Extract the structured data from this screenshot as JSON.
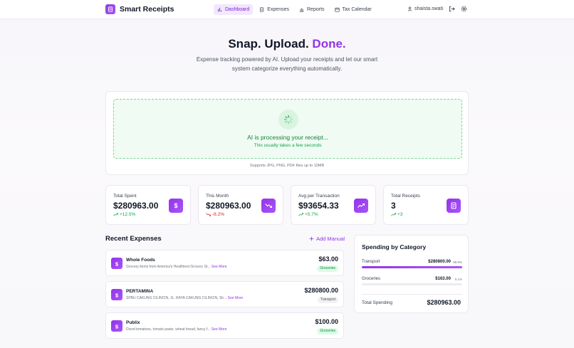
{
  "app": {
    "name": "Smart Receipts"
  },
  "nav": [
    {
      "label": "Dashboard",
      "icon": "bar-chart-icon",
      "active": true
    },
    {
      "label": "Expenses",
      "icon": "receipt-icon",
      "active": false
    },
    {
      "label": "Reports",
      "icon": "bar-chart-icon",
      "active": false
    },
    {
      "label": "Tax Calendar",
      "icon": "calendar-icon",
      "active": false
    }
  ],
  "user": {
    "name": "shaista.swati"
  },
  "hero": {
    "title_main": "Snap. Upload.",
    "title_accent": "Done.",
    "subtitle": "Expense tracking powered by AI. Upload your receipts and let our smart system categorize everything automatically."
  },
  "upload": {
    "status": "AI is processing your receipt...",
    "status_sub": "This usually takes a few seconds",
    "supports": "Supports JPG, PNG, PDF files up to 10MB"
  },
  "stats": [
    {
      "label": "Total Spent",
      "value": "$280963.00",
      "change": "+12.5%",
      "direction": "up",
      "icon": "dollar-icon"
    },
    {
      "label": "This Month",
      "value": "$280963.00",
      "change": "-8.2%",
      "direction": "down",
      "icon": "trend-down-icon"
    },
    {
      "label": "Avg per Transaction",
      "value": "$93654.33",
      "change": "+5.7%",
      "direction": "up",
      "icon": "trend-up-icon"
    },
    {
      "label": "Total Receipts",
      "value": "3",
      "change": "+3",
      "direction": "up",
      "icon": "receipt-icon"
    }
  ],
  "recent": {
    "title": "Recent Expenses",
    "add_label": "Add Manual",
    "see_more": "See More",
    "items": [
      {
        "merchant": "Whole Foods",
        "description": "Grocery items from America's Healthiest Grocery St...",
        "amount": "$63.00",
        "category": "Groceries",
        "badge_color": "#dcfce7"
      },
      {
        "merchant": "PERTAMINA",
        "description": "SPBU CAKUNG CILINCIN, JL. RAYA CAKUNG CILINCIN, Sh...",
        "amount": "$280800.00",
        "category": "Transport",
        "badge_color": "#f1f1f4"
      },
      {
        "merchant": "Publix",
        "description": "Diced tomatoes, tomato paste, wheat bread, fancy f...",
        "amount": "$100.00",
        "category": "Groceries",
        "badge_color": "#dcfce7"
      }
    ]
  },
  "categories": {
    "title": "Spending by Category",
    "items": [
      {
        "name": "Transport",
        "amount": "$280800.00",
        "percent": "99.9%",
        "share": 0.999
      },
      {
        "name": "Groceries",
        "amount": "$163.00",
        "percent": "0.1%",
        "share": 0.001
      }
    ],
    "total_label": "Total Spending",
    "total": "$280963.00"
  },
  "colors": {
    "accent": "#9333ea",
    "success": "#16a34a",
    "danger": "#dc2626"
  }
}
